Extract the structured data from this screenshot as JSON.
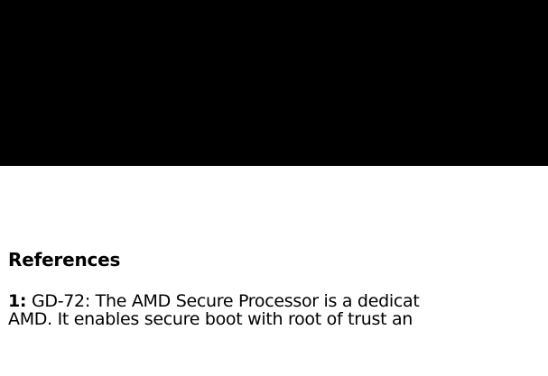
{
  "banner": {
    "background_color": "#000000"
  },
  "references": {
    "heading": "References",
    "items": [
      {
        "number": "1:",
        "line1": " GD-72: The AMD Secure Processor is a dedicat",
        "line2": "AMD. It enables secure boot with root of trust an"
      }
    ]
  }
}
